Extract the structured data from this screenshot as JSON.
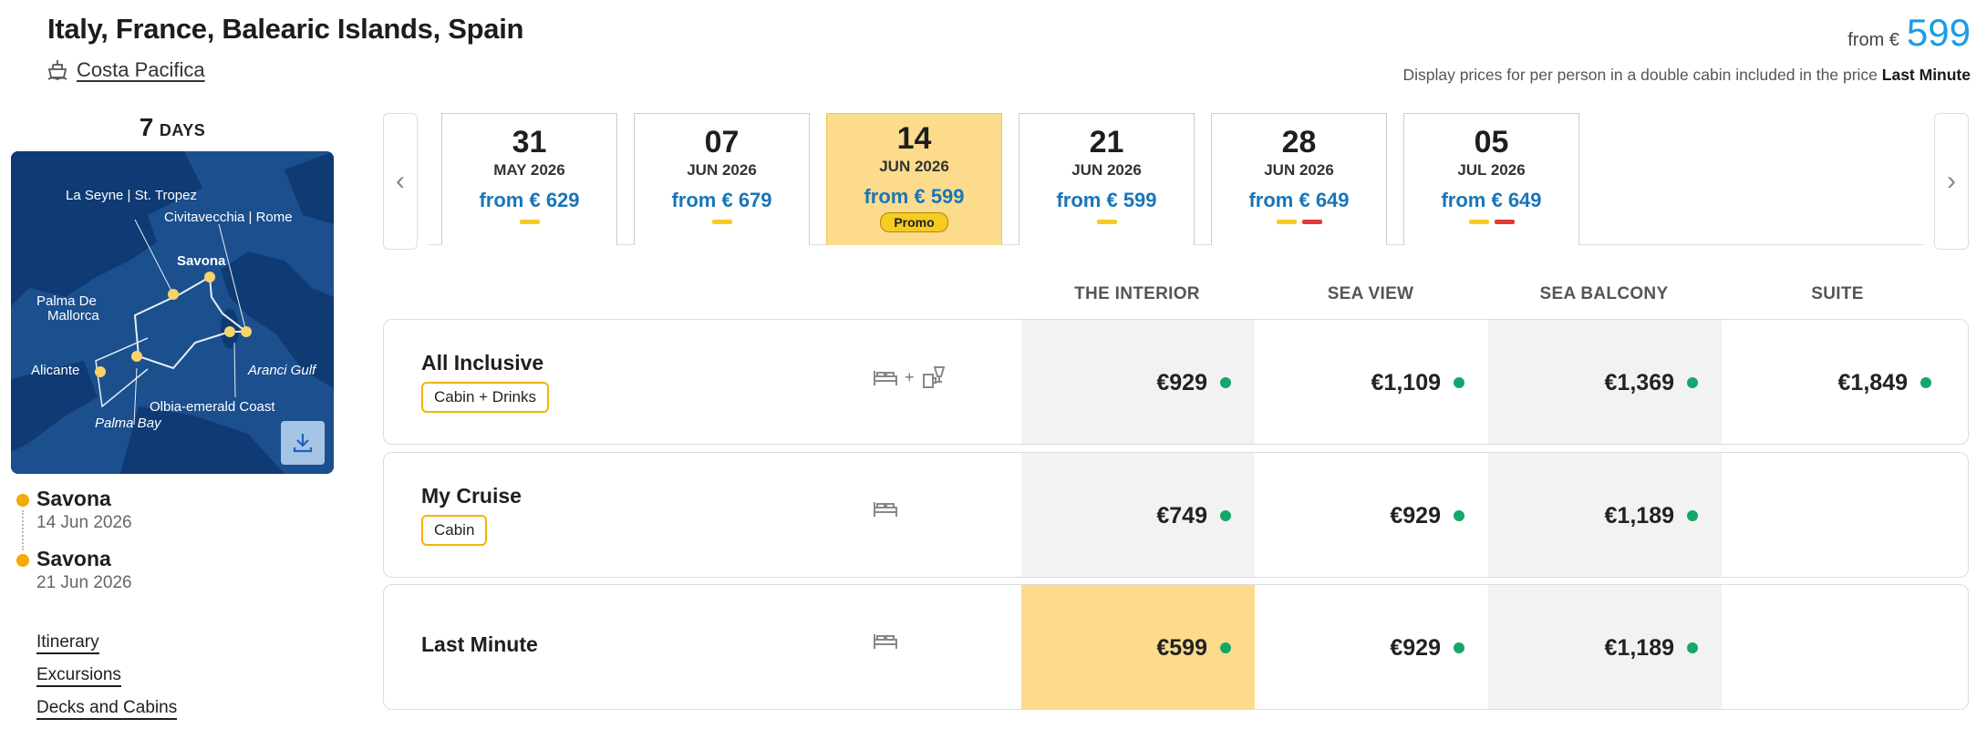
{
  "header": {
    "title": "Italy, France, Balearic Islands, Spain",
    "ship_name": "Costa Pacifica",
    "price_from_label": "from €",
    "price_from_value": "599",
    "price_note_prefix": "Display prices for per person in a double cabin included in the price",
    "price_note_fare": "Last Minute"
  },
  "sidebar": {
    "days_number": "7",
    "days_label": "DAYS",
    "map_labels": [
      "La Seyne | St. Tropez",
      "Civitavecchia | Rome",
      "Savona",
      "Palma De",
      "Mallorca",
      "Alicante",
      "Aranci Gulf",
      "Olbia-emerald Coast",
      "Palma Bay"
    ],
    "stops": [
      {
        "port": "Savona",
        "date": "14 Jun 2026"
      },
      {
        "port": "Savona",
        "date": "21 Jun 2026"
      }
    ],
    "links": [
      "Itinerary",
      "Excursions",
      "Decks and Cabins"
    ]
  },
  "dates": [
    {
      "day": "31",
      "month": "MAY 2026",
      "price": "from € 629",
      "bars": [
        "yellow"
      ],
      "selected": false,
      "promo": ""
    },
    {
      "day": "07",
      "month": "JUN 2026",
      "price": "from € 679",
      "bars": [
        "yellow"
      ],
      "selected": false,
      "promo": ""
    },
    {
      "day": "14",
      "month": "JUN 2026",
      "price": "from € 599",
      "bars": [],
      "selected": true,
      "promo": "Promo"
    },
    {
      "day": "21",
      "month": "JUN 2026",
      "price": "from € 599",
      "bars": [
        "yellow"
      ],
      "selected": false,
      "promo": ""
    },
    {
      "day": "28",
      "month": "JUN 2026",
      "price": "from € 649",
      "bars": [
        "yellow",
        "red"
      ],
      "selected": false,
      "promo": ""
    },
    {
      "day": "05",
      "month": "JUL 2026",
      "price": "from € 649",
      "bars": [
        "yellow",
        "red"
      ],
      "selected": false,
      "promo": ""
    }
  ],
  "cabin_types": [
    "THE INTERIOR",
    "SEA VIEW",
    "SEA BALCONY",
    "SUITE"
  ],
  "fares": [
    {
      "name": "All Inclusive",
      "badge": "Cabin + Drinks",
      "icon": "bed-plus-drinks-icon",
      "icon_plus": "+",
      "prices": [
        "€929",
        "€1,109",
        "€1,369",
        "€1,849"
      ]
    },
    {
      "name": "My Cruise",
      "badge": "Cabin",
      "icon": "bed-icon",
      "prices": [
        "€749",
        "€929",
        "€1,189",
        ""
      ]
    },
    {
      "name": "Last Minute",
      "badge": "",
      "icon": "bed-icon",
      "prices": [
        "€599",
        "€929",
        "€1,189",
        ""
      ]
    }
  ],
  "colors": {
    "accent_blue": "#1d9be6",
    "price_blue": "#1a75b8",
    "highlight_yellow": "#fcdc8c",
    "availability_green": "#14a76c",
    "bar_yellow": "#f6cb22",
    "bar_red": "#e53935"
  }
}
